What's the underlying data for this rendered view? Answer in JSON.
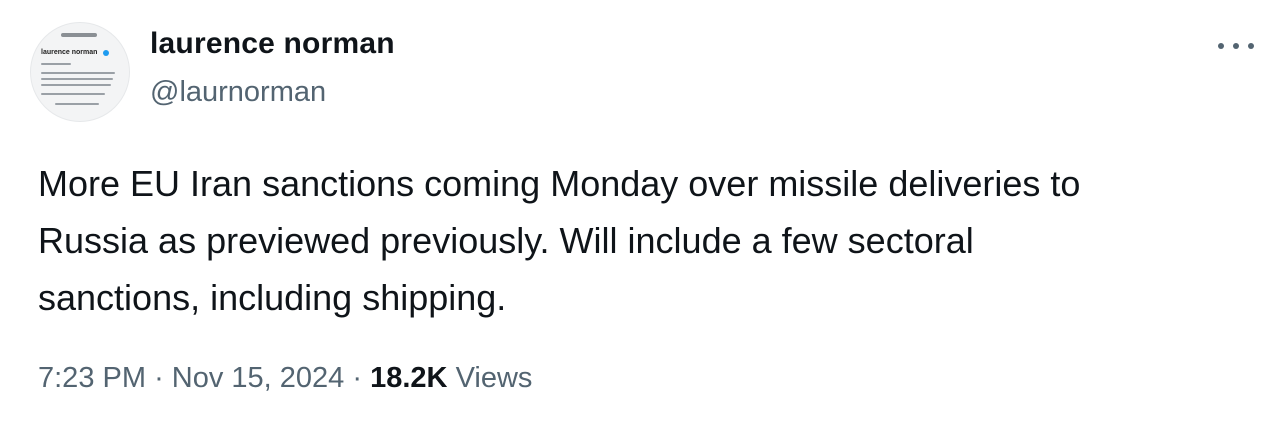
{
  "author": {
    "display_name": "laurence norman",
    "handle": "@laurnorman",
    "avatar_icon": "profile-screenshot-avatar",
    "avatar_text": {
      "name": "laurence norman",
      "handle": "@laurnorman",
      "bio_lines": [
        "In Europe for The Wall Street Journal",
        "nuclear, EU, European foreign policy",
        "that comes my way. My RT, someor"
      ],
      "stats": "Following 29.8K Followers"
    }
  },
  "menu": {
    "icon": "more-horizontal-icon"
  },
  "tweet": {
    "lines": [
      "More EU Iran sanctions coming Monday over missile deliveries to",
      "Russia as previewed previously. Will include a few sectoral",
      "sanctions, including shipping."
    ]
  },
  "meta": {
    "time": "7:23 PM",
    "separator": "·",
    "date": "Nov 15, 2024",
    "views_count": "18.2K",
    "views_label": "Views"
  },
  "colors": {
    "primary_text": "#0f1419",
    "secondary_text": "#536471",
    "verified": "#1d9bf0",
    "background": "#ffffff"
  }
}
